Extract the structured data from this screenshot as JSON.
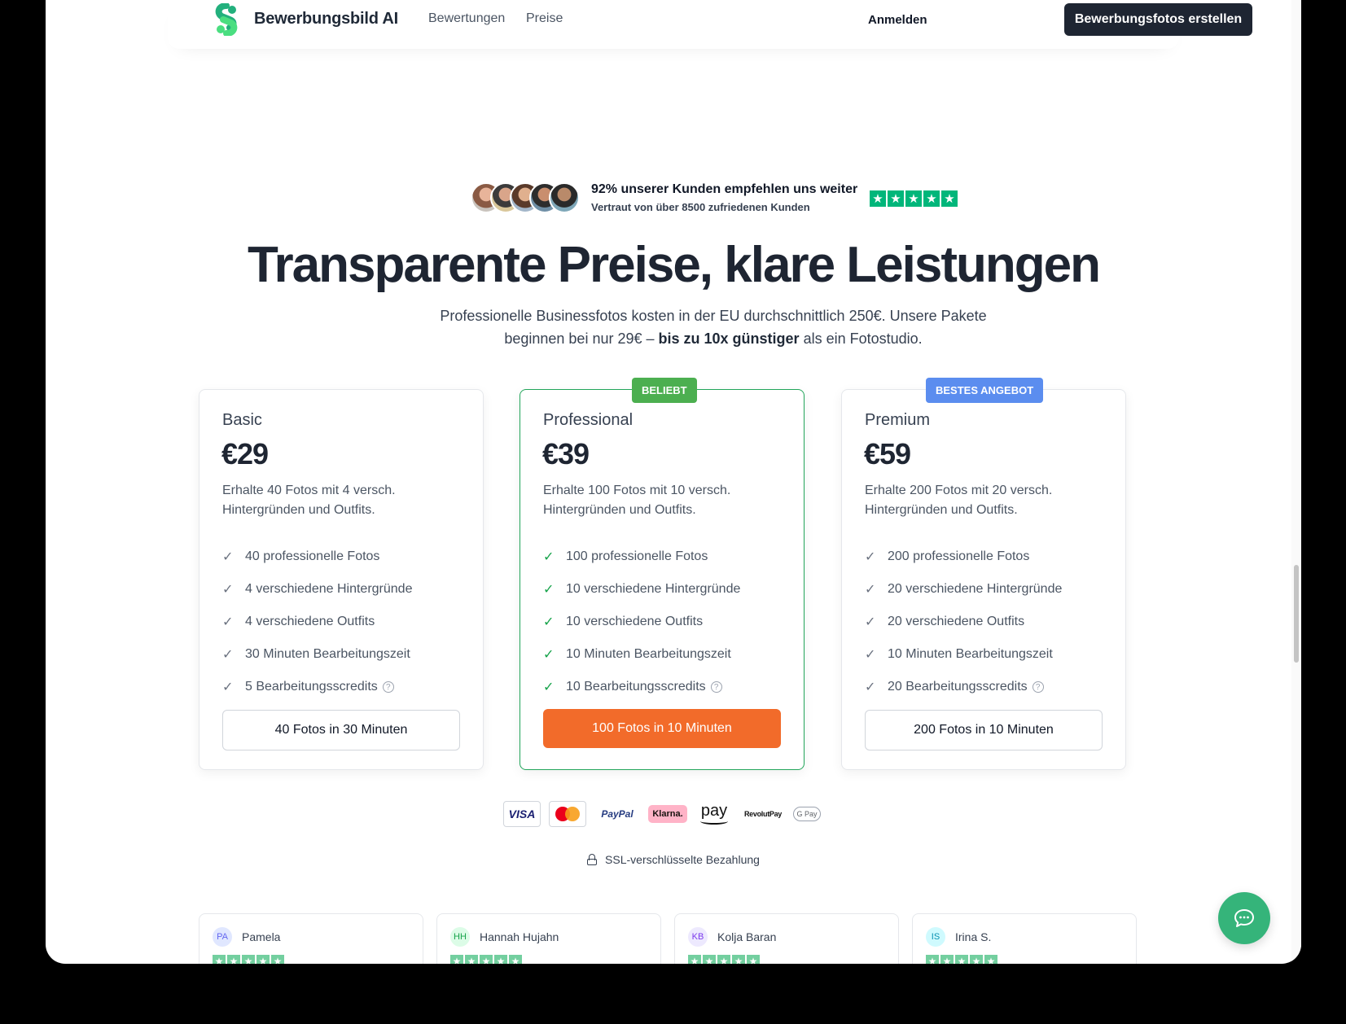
{
  "header": {
    "brand": "Bewerbungsbild AI",
    "nav": [
      "Bewertungen",
      "Preise"
    ],
    "login": "Anmelden",
    "cta": "Bewerbungsfotos erstellen"
  },
  "social_proof": {
    "title": "92% unserer Kunden empfehlen uns weiter",
    "subtitle": "Vertraut von über 8500 zufriedenen Kunden",
    "star": "★"
  },
  "hero": {
    "headline": "Transparente Preise, klare Leistungen",
    "sub_line1": "Professionelle Businessfotos kosten in der EU durchschnittlich 250€. Unsere Pakete beginnen bei nur 29€ – ",
    "sub_bold": "bis zu 10x günstiger",
    "sub_line2": " als ein Fotostudio."
  },
  "plans": [
    {
      "name": "Basic",
      "price": "€29",
      "desc": "Erhalte 40 Fotos mit 4 versch. Hintergründen und Outfits.",
      "features": [
        "40 professionelle Fotos",
        "4 verschiedene Hintergründe",
        "4 verschiedene Outfits",
        "30 Minuten Bearbeitungszeit",
        "5 Bearbeitungsscredits"
      ],
      "button": "40 Fotos in 30 Minuten"
    },
    {
      "name": "Professional",
      "badge": "BELIEBT",
      "price": "€39",
      "desc": "Erhalte 100 Fotos mit 10 versch. Hintergründen und Outfits.",
      "features": [
        "100 professionelle Fotos",
        "10 verschiedene Hintergründe",
        "10 verschiedene Outfits",
        "10 Minuten Bearbeitungszeit",
        "10 Bearbeitungsscredits"
      ],
      "button": "100 Fotos in 10 Minuten"
    },
    {
      "name": "Premium",
      "badge": "BESTES ANGEBOT",
      "price": "€59",
      "desc": "Erhalte 200 Fotos mit 20 versch. Hintergründen und Outfits.",
      "features": [
        "200 professionelle Fotos",
        "20 verschiedene Hintergründe",
        "20 verschiedene Outfits",
        "10 Minuten Bearbeitungszeit",
        "20 Bearbeitungsscredits"
      ],
      "button": "200 Fotos in 10 Minuten"
    }
  ],
  "payments": {
    "visa": "VISA",
    "paypal": "PayPal",
    "klarna": "Klarna.",
    "amazon": "pay",
    "revolut": "RevolutPay",
    "gpay": "G Pay"
  },
  "ssl": "SSL-verschlüsselte Bezahlung",
  "reviews": [
    {
      "initials": "PA",
      "name": "Pamela",
      "bg": "#e0e7ff",
      "fg": "#6366f1"
    },
    {
      "initials": "HH",
      "name": "Hannah Hujahn",
      "bg": "#dcfce7",
      "fg": "#16a34a"
    },
    {
      "initials": "KB",
      "name": "Kolja Baran",
      "bg": "#ede9fe",
      "fg": "#7c3aed"
    },
    {
      "initials": "IS",
      "name": "Irina S.",
      "bg": "#cffafe",
      "fg": "#0891b2"
    }
  ],
  "check_glyph": "✓",
  "help_glyph": "?",
  "colors": {
    "accent_orange": "#f26b2a",
    "accent_green": "#22a55a",
    "dark": "#1e2532",
    "trustpilot": "#00b67a"
  }
}
